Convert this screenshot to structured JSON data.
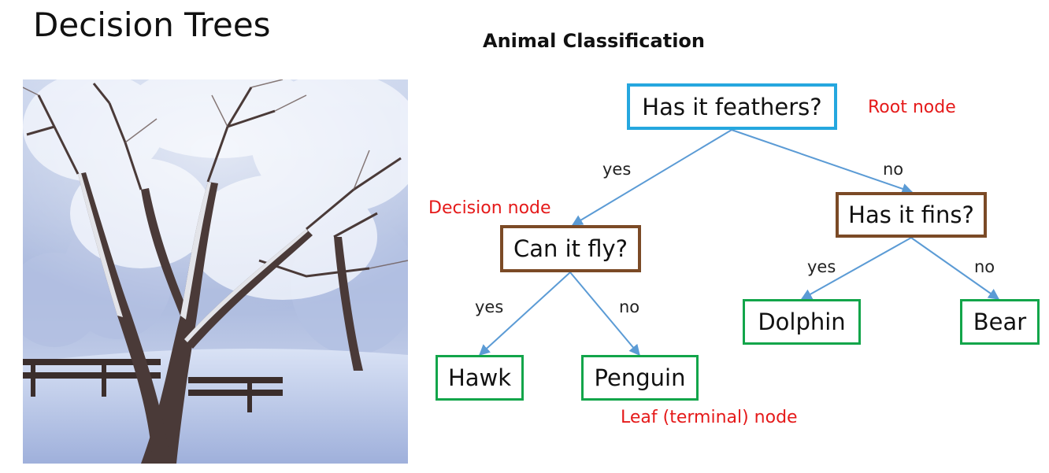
{
  "slide": {
    "title": "Decision Trees"
  },
  "photo": {
    "subject-icon": "snowy-trees-photo"
  },
  "diagram": {
    "title": "Animal Classification",
    "colors": {
      "root_border": "#25a7df",
      "decision_border": "#7b4a26",
      "leaf_border": "#12a54a",
      "annotation": "#e51a1a",
      "edge": "#5b9bd5"
    },
    "nodes": {
      "root": "Has it feathers?",
      "fly": "Can it fly?",
      "fins": "Has it fins?",
      "hawk": "Hawk",
      "penguin": "Penguin",
      "dolphin": "Dolphin",
      "bear": "Bear"
    },
    "edges": {
      "root_yes": "yes",
      "root_no": "no",
      "fly_yes": "yes",
      "fly_no": "no",
      "fins_yes": "yes",
      "fins_no": "no"
    },
    "annotations": {
      "root": "Root node",
      "decision": "Decision node",
      "leaf": "Leaf (terminal) node"
    }
  }
}
